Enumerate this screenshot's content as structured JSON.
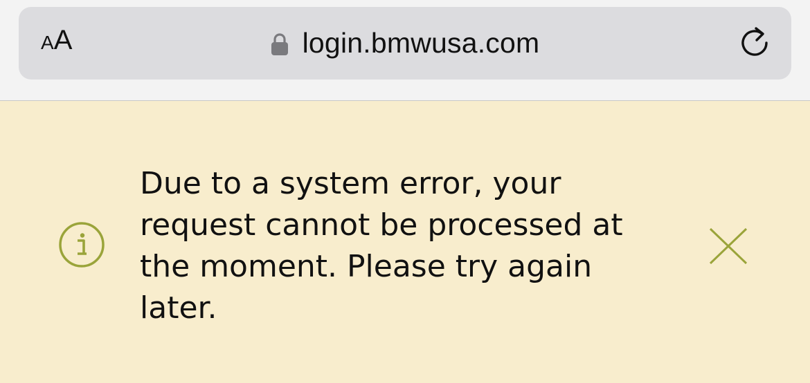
{
  "browser": {
    "text_size_label_small": "A",
    "text_size_label_large": "A",
    "url": "login.bmwusa.com",
    "icons": {
      "lock": "lock-icon",
      "reload": "reload-icon"
    }
  },
  "alert": {
    "message": "Due to a system error, your\nrequest cannot be processed at\nthe moment. Please try again\nlater.",
    "icons": {
      "info": "info-icon",
      "close": "close-icon"
    },
    "colors": {
      "background": "#f8edcd",
      "accent": "#9aa43a",
      "text": "#111111"
    }
  }
}
